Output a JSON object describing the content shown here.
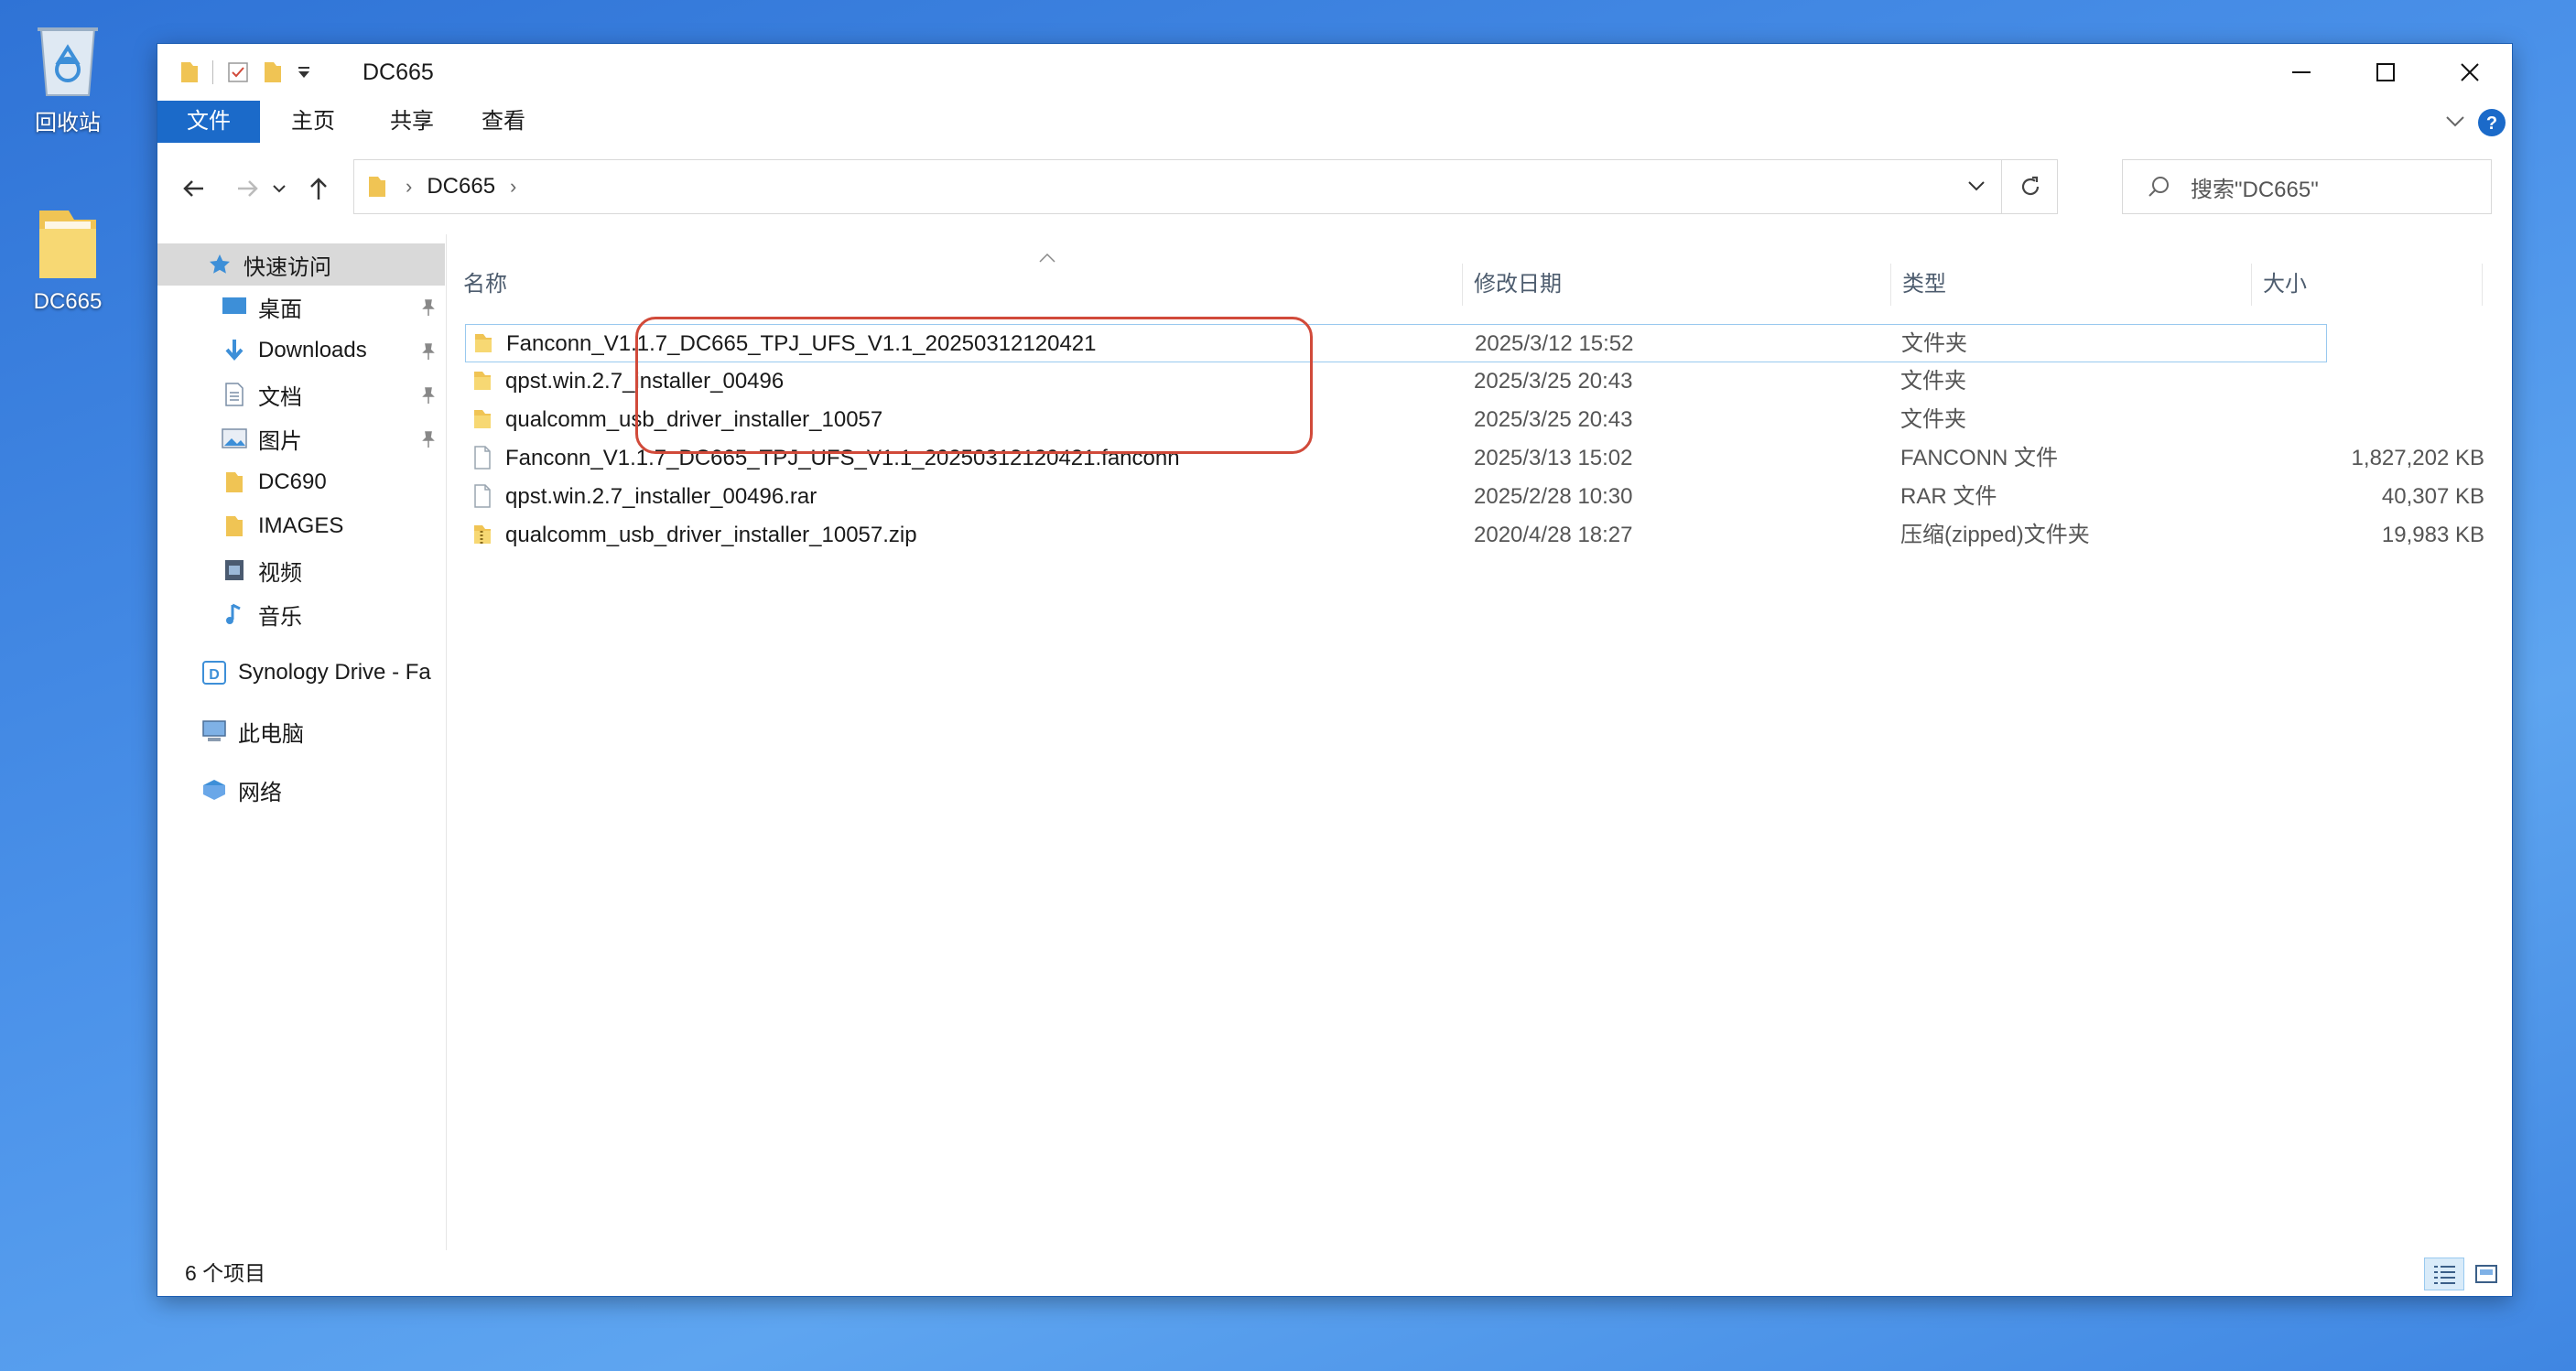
{
  "desktop": {
    "icons": [
      {
        "label": "回收站",
        "icon": "recycle-bin-icon"
      },
      {
        "label": "DC665",
        "icon": "folder-icon"
      }
    ]
  },
  "window": {
    "title": "DC665",
    "ribbon_tabs": [
      "文件",
      "主页",
      "共享",
      "查看"
    ],
    "address": {
      "path": [
        "DC665"
      ]
    },
    "search": {
      "placeholder": "搜索\"DC665\""
    },
    "nav": {
      "quick_access": "快速访问",
      "items": [
        {
          "label": "桌面",
          "icon": "desktop-icon",
          "pinned": true
        },
        {
          "label": "Downloads",
          "icon": "download-icon",
          "pinned": true
        },
        {
          "label": "文档",
          "icon": "documents-icon",
          "pinned": true
        },
        {
          "label": "图片",
          "icon": "pictures-icon",
          "pinned": true
        },
        {
          "label": "DC690",
          "icon": "folder-icon",
          "pinned": false
        },
        {
          "label": "IMAGES",
          "icon": "folder-icon",
          "pinned": false
        },
        {
          "label": "视频",
          "icon": "video-icon",
          "pinned": false
        },
        {
          "label": "音乐",
          "icon": "music-icon",
          "pinned": false
        }
      ],
      "synology": "Synology Drive - Fa",
      "this_pc": "此电脑",
      "network": "网络"
    },
    "columns": {
      "name": "名称",
      "date": "修改日期",
      "type": "类型",
      "size": "大小"
    },
    "files": [
      {
        "name": "Fanconn_V1.1.7_DC665_TPJ_UFS_V1.1_20250312120421",
        "date": "2025/3/12 15:52",
        "type": "文件夹",
        "size": "",
        "icon": "folder-icon"
      },
      {
        "name": "qpst.win.2.7_installer_00496",
        "date": "2025/3/25 20:43",
        "type": "文件夹",
        "size": "",
        "icon": "folder-icon"
      },
      {
        "name": "qualcomm_usb_driver_installer_10057",
        "date": "2025/3/25 20:43",
        "type": "文件夹",
        "size": "",
        "icon": "folder-icon"
      },
      {
        "name": "Fanconn_V1.1.7_DC665_TPJ_UFS_V1.1_20250312120421.fanconn",
        "date": "2025/3/13 15:02",
        "type": "FANCONN 文件",
        "size": "1,827,202 KB",
        "icon": "file-icon"
      },
      {
        "name": "qpst.win.2.7_installer_00496.rar",
        "date": "2025/2/28 10:30",
        "type": "RAR 文件",
        "size": "40,307 KB",
        "icon": "file-icon"
      },
      {
        "name": "qualcomm_usb_driver_installer_10057.zip",
        "date": "2020/4/28 18:27",
        "type": "压缩(zipped)文件夹",
        "size": "19,983 KB",
        "icon": "zip-folder-icon"
      }
    ],
    "status": "6 个项目"
  },
  "colors": {
    "accent": "#1b6ac9",
    "annotation": "#d14a3a",
    "selection_border": "#99c9ef",
    "folder": "#f3c94f"
  }
}
